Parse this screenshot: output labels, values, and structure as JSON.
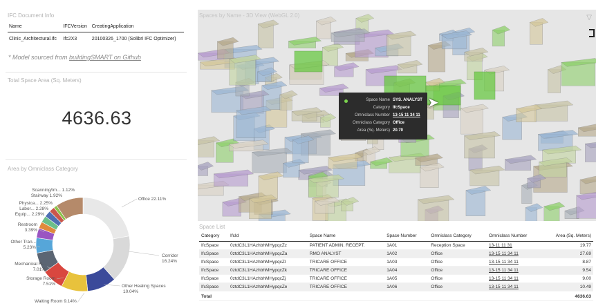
{
  "ifc_info": {
    "title": "IFC Document Info",
    "headers": [
      "Name",
      "IFCVersion",
      "CreatingApplication"
    ],
    "row": [
      "Clinic_Architectural.ifc",
      "Ifc2X3",
      "20100326_1700 (Solibri IFC Optimizer)"
    ],
    "note_prefix": "* Model sourced from ",
    "note_link": "buildingSMART on Github"
  },
  "total_area": {
    "title": "Total Space Area (Sq. Meters)",
    "value": "4636.63"
  },
  "area_chart": {
    "title": "Area by Omniclass Category"
  },
  "chart_data": {
    "type": "pie",
    "title": "Area by Omniclass Category",
    "slices": [
      {
        "label": "Office",
        "percent": 22.11,
        "color": "#e8e8e8"
      },
      {
        "label": "Corridor",
        "percent": 16.24,
        "color": "#d9d9d9"
      },
      {
        "label": "Other Healing Spaces",
        "percent": 10.04,
        "color": "#3b4a9a"
      },
      {
        "label": "Waiting Room",
        "percent": 9.14,
        "color": "#e8c23c"
      },
      {
        "label": "Storage Room",
        "percent": 7.51,
        "color": "#d9473f"
      },
      {
        "label": "Mechanical R...",
        "percent": 7.01,
        "color": "#5b6573"
      },
      {
        "label": "Other Tran...",
        "percent": 5.23,
        "color": "#56a6d9"
      },
      {
        "label": "Restroom",
        "percent": 3.39,
        "color": "#9a55c2"
      },
      {
        "label": "Equip...",
        "percent": 2.29,
        "color": "#e08a3c"
      },
      {
        "label": "Labor...",
        "percent": 2.28,
        "color": "#6cbf8a"
      },
      {
        "label": "Physica...",
        "percent": 2.25,
        "color": "#4e6fb3"
      },
      {
        "label": "Stairway",
        "percent": 1.92,
        "color": "#c9574c"
      },
      {
        "label": "Scanning/Im...",
        "percent": 1.12,
        "color": "#8bc34a"
      },
      {
        "label": "",
        "percent": 9.47,
        "color": "#b58a6a"
      }
    ],
    "labels": [
      {
        "text": "Office 22.11%"
      },
      {
        "text": "Corridor"
      },
      {
        "text": "16.24%"
      },
      {
        "text": "Other Healing Spaces"
      },
      {
        "text": "10.04%"
      },
      {
        "text": "Waiting Room 9.14%"
      },
      {
        "text": "Storage Room"
      },
      {
        "text": "7.51%"
      },
      {
        "text": "Mechanical R..."
      },
      {
        "text": "7.01%"
      },
      {
        "text": "Other Tran..."
      },
      {
        "text": "5.23%"
      },
      {
        "text": "Restroom"
      },
      {
        "text": "3.39%"
      },
      {
        "text": "Equip... 2.29%"
      },
      {
        "text": "Labor... 2.28%"
      },
      {
        "text": "Physica... 2.25%"
      },
      {
        "text": "Stairway 1.92%"
      },
      {
        "text": "Scanning/Im... 1.12%"
      }
    ]
  },
  "view3d": {
    "title": "Spaces by Name - 3D View (WebGL 2.0)",
    "tooltip": [
      {
        "key": "Space Name",
        "value": "SYS. ANALYST"
      },
      {
        "key": "Category",
        "value": "IfcSpace"
      },
      {
        "key": "Omniclass Number",
        "value": "13-15 11 34 11"
      },
      {
        "key": "Omniclass Category",
        "value": "Office"
      },
      {
        "key": "Area (Sq. Meters)",
        "value": "20.70"
      }
    ]
  },
  "space_list": {
    "title": "Space List",
    "headers": [
      "Category",
      "IfcId",
      "Space Name",
      "Space Number",
      "Omniclass Category",
      "Omniclass Number",
      "Area (Sq. Meters)"
    ],
    "rows": [
      [
        "IfcSpace",
        "0ztdC3L1HAzhbhMHypqcZz",
        "PATIENT ADMIN. RECEPT.",
        "1A01",
        "Reception Space",
        "13-11 11 31",
        "19.77"
      ],
      [
        "IfcSpace",
        "0ztdC3L1HAzhbhMHypqcZa",
        "RMO ANALYST",
        "1A02",
        "Office",
        "13-15 11 34 11",
        "27.69"
      ],
      [
        "IfcSpace",
        "0ztdC3L1HAzhbhMHypqcZl",
        "TRICARE OFFICE",
        "1A03",
        "Office",
        "13-15 11 34 11",
        "8.87"
      ],
      [
        "IfcSpace",
        "0ztdC3L1HAzhbhMHypqcZk",
        "TRICARE OFFICE",
        "1A04",
        "Office",
        "13-15 11 34 11",
        "9.54"
      ],
      [
        "IfcSpace",
        "0ztdC3L1HAzhbhMHypqcZj",
        "TRICARE OFFICE",
        "1A05",
        "Office",
        "13-15 11 34 11",
        "9.00"
      ],
      [
        "IfcSpace",
        "0ztdC3L1HAzhbhMHypqcZe",
        "TRICARE OFFICE",
        "1A06",
        "Office",
        "13-15 11 34 11",
        "10.49"
      ]
    ],
    "total_label": "Total",
    "total_value": "4636.63"
  }
}
